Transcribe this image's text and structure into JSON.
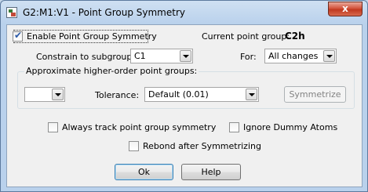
{
  "window": {
    "title": "G2:M1:V1 - Point Group Symmetry",
    "close_glyph": "x",
    "icon": "app-document-icon"
  },
  "enable_symmetry": {
    "label": "Enable Point Group Symmetry",
    "checked": true
  },
  "current_point_group": {
    "label": "Current point group:",
    "value": "C2h"
  },
  "constrain": {
    "label": "Constrain to subgroup:",
    "value": "C1"
  },
  "for_field": {
    "label": "For:",
    "value": "All changes"
  },
  "approx_group": {
    "title": "Approximate higher-order point groups:",
    "group_value": "",
    "tolerance_label": "Tolerance:",
    "tolerance_value": "Default (0.01)",
    "symmetrize_label": "Symmetrize"
  },
  "always_track": {
    "label": "Always track point group symmetry",
    "checked": false
  },
  "ignore_dummy": {
    "label": "Ignore Dummy Atoms",
    "checked": false
  },
  "rebond": {
    "label": "Rebond after Symmetrizing",
    "checked": false
  },
  "buttons": {
    "ok": "Ok",
    "help": "Help"
  },
  "colors": {
    "accent_check": "#2b5aa8",
    "close_red": "#c0391f"
  }
}
